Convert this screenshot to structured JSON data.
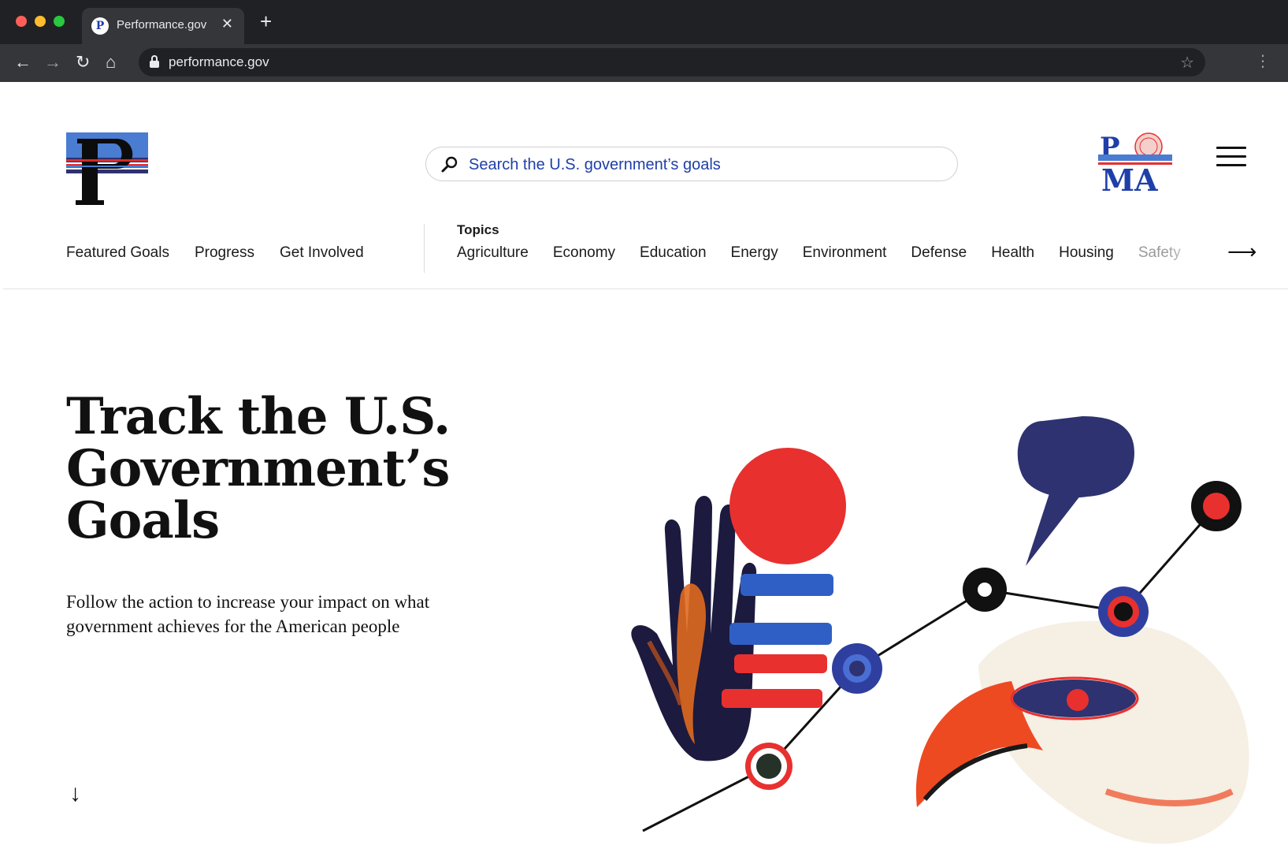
{
  "browser": {
    "tab_title": "Performance.gov",
    "tab_close": "✕",
    "new_tab": "+",
    "url": "performance.gov",
    "back": "←",
    "forward": "→",
    "reload": "↻",
    "home": "⌂",
    "bookmark": "☆",
    "menu": "⋮"
  },
  "header": {
    "search_placeholder": "Search the U.S. government’s goals",
    "logo_icon": "p-logo-icon",
    "pma_icon": "pma-logo-icon",
    "menu_icon": "hamburger-icon"
  },
  "nav": {
    "main": [
      "Featured Goals",
      "Progress",
      "Get Involved"
    ],
    "topics_label": "Topics",
    "topics": [
      "Agriculture",
      "Economy",
      "Education",
      "Energy",
      "Environment",
      "Defense",
      "Health",
      "Housing",
      "Safety"
    ],
    "next_arrow": "⟶"
  },
  "hero": {
    "title_lines": [
      "Track the U.S.",
      "Government’s",
      "Goals"
    ],
    "subtitle": "Follow the action to increase your impact on what government achieves for the American people",
    "scroll_arrow": "↓"
  },
  "colors": {
    "brand_blue": "#1f3fa8",
    "navy": "#2e3270",
    "red": "#e8302f",
    "orange": "#e8501f"
  }
}
